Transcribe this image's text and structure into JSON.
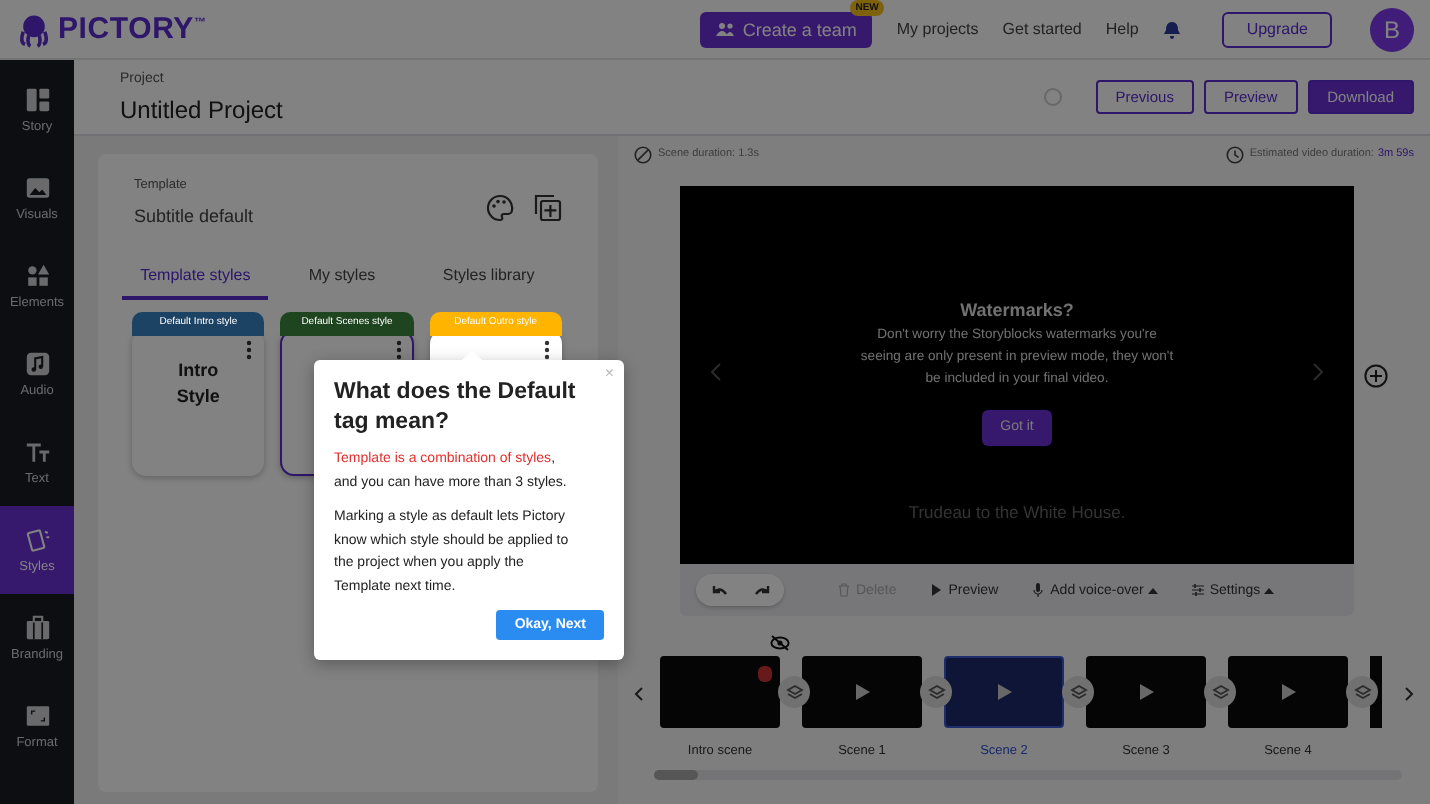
{
  "header": {
    "logo": "PICTORY$^{™}$",
    "create_team": {
      "label": "Create a team",
      "badge": "NEW"
    },
    "nav": [
      "My projects",
      "Get started",
      "Help"
    ],
    "upgrade": "Upgrade",
    "avatar": "B"
  },
  "sidebar": {
    "items": [
      {
        "label": "Story",
        "kind": "story",
        "selected": false
      },
      {
        "label": "Visuals",
        "kind": "visuals",
        "selected": false
      },
      {
        "label": "Elements",
        "kind": "elements",
        "selected": false
      },
      {
        "label": "Audio",
        "kind": "audio",
        "selected": false
      },
      {
        "label": "Text",
        "kind": "text",
        "selected": false
      },
      {
        "label": "Styles",
        "kind": "styles",
        "selected": true
      },
      {
        "label": "Branding",
        "kind": "branding",
        "selected": false
      },
      {
        "label": "Format",
        "kind": "format",
        "selected": false
      }
    ]
  },
  "project": {
    "label": "Project",
    "title": "Untitled Project",
    "actions": [
      {
        "label": "Previous",
        "kind": "outline"
      },
      {
        "label": "Preview",
        "kind": "outline"
      },
      {
        "label": "Download",
        "kind": "primary"
      }
    ]
  },
  "template": {
    "label": "Template",
    "value": "Subtitle default"
  },
  "tabs": [
    {
      "label": "Template styles",
      "selected": true
    },
    {
      "label": "My styles",
      "selected": false
    },
    {
      "label": "Styles library",
      "selected": false
    }
  ],
  "style_cards": [
    {
      "tag": "Default Intro style",
      "color": "#1d4364",
      "title": "Intro Style",
      "selected": false,
      "highlighted": false
    },
    {
      "tag": "Default Scenes style",
      "color": "#1e451f",
      "selected": true,
      "highlighted": false
    },
    {
      "tag": "Default Outro style",
      "color": "#ffb400",
      "selected": false,
      "highlighted": true
    }
  ],
  "popover": {
    "close": "×",
    "title": "What does the Default tag mean?",
    "highlight": "Template is a combination of styles",
    "text": ", and you can have more than 3 styles.",
    "paragraph": "Marking a style as default lets Pictory know which style should be applied to the project when you apply the Template next time.",
    "button": "Okay, Next"
  },
  "editor": {
    "scene_duration": {
      "label": "Scene duration:",
      "value": "1.3s"
    },
    "estimated_duration": {
      "label": "Estimated video duration:",
      "value": "3m 59s"
    },
    "notice": {
      "title": "Watermarks?",
      "text": "Don't worry the Storyblocks watermarks you're seeing are only present in preview mode, they won't be included in your final video.",
      "button": "Got it"
    },
    "subtitle": "Trudeau to the White House.",
    "toolbar": [
      {
        "label": "Delete",
        "kind": "trash",
        "disabled": true,
        "dropdown": false
      },
      {
        "label": "Preview",
        "kind": "play",
        "disabled": false,
        "dropdown": false
      },
      {
        "label": "Add voice-over",
        "kind": "mic",
        "disabled": false,
        "dropdown": true
      },
      {
        "label": "Settings",
        "kind": "sliders",
        "disabled": false,
        "dropdown": true
      }
    ]
  },
  "scenes": [
    {
      "label": "Intro scene",
      "kind": "intro",
      "selected": false
    },
    {
      "label": "Scene 1",
      "kind": "scene",
      "selected": false
    },
    {
      "label": "Scene 2",
      "kind": "scene",
      "selected": true
    },
    {
      "label": "Scene 3",
      "kind": "scene",
      "selected": false
    },
    {
      "label": "Scene 4",
      "kind": "scene",
      "selected": false
    }
  ]
}
